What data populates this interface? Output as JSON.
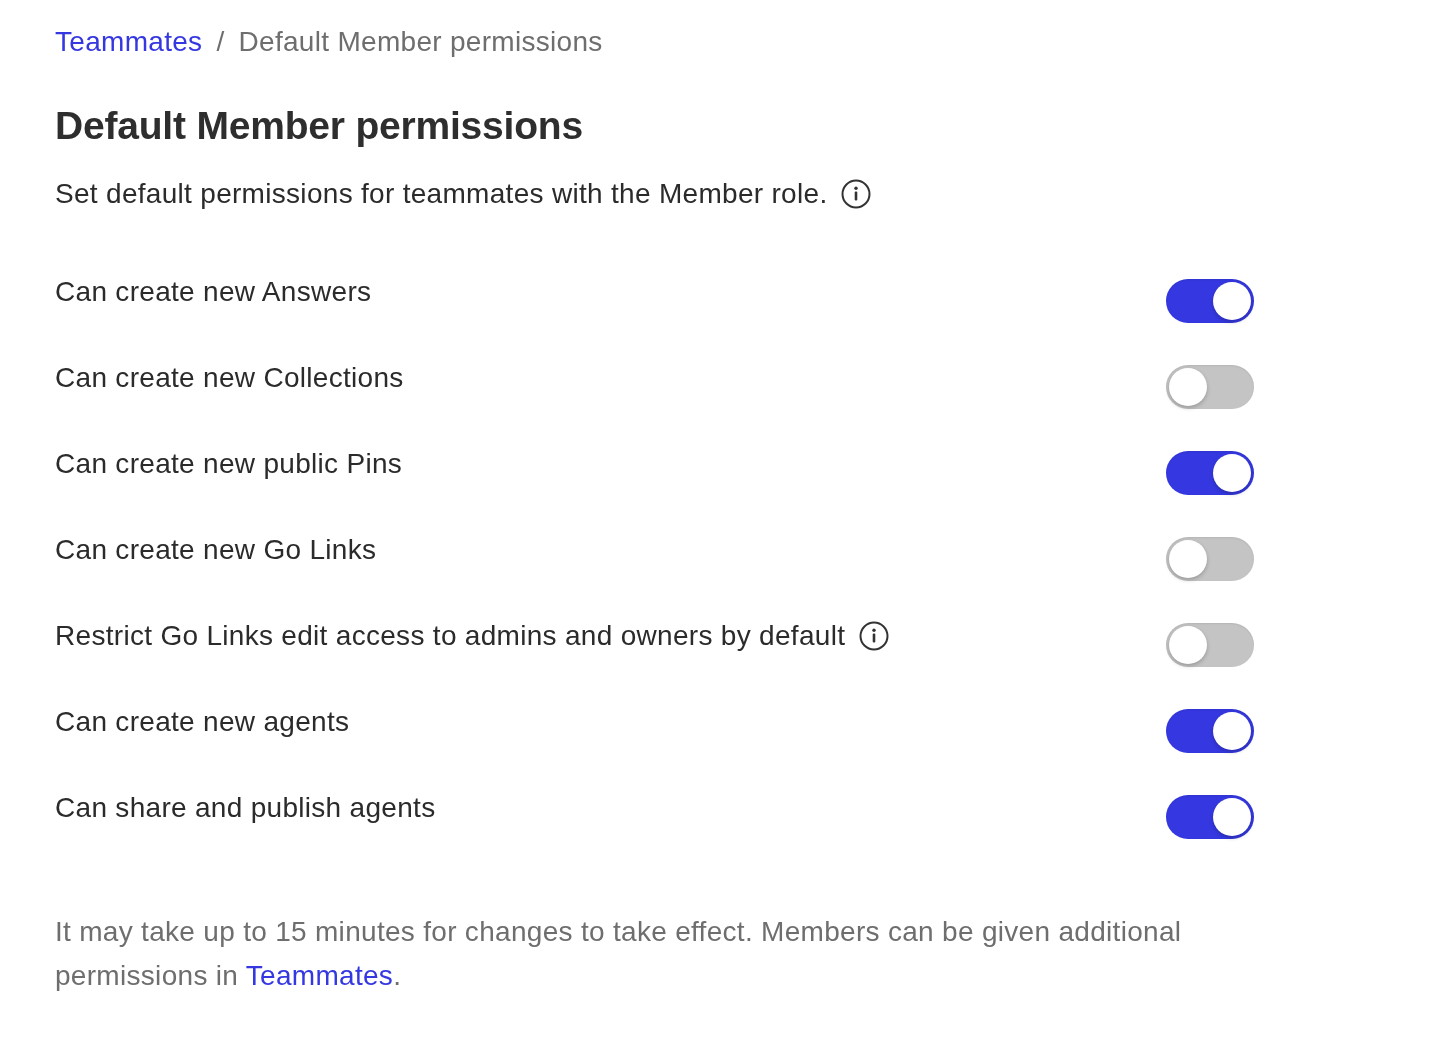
{
  "breadcrumb": {
    "link": "Teammates",
    "separator": "/",
    "current": "Default Member permissions"
  },
  "title": "Default Member permissions",
  "subtitle": {
    "text": "Set default permissions for teammates with the Member role.",
    "info": true
  },
  "permissions": [
    {
      "label": "Can create new Answers",
      "info": false,
      "on": true
    },
    {
      "label": "Can create new Collections",
      "info": false,
      "on": false
    },
    {
      "label": "Can create new public Pins",
      "info": false,
      "on": true
    },
    {
      "label": "Can create new Go Links",
      "info": false,
      "on": false
    },
    {
      "label": "Restrict Go Links edit access to admins and owners by default",
      "info": true,
      "on": false
    },
    {
      "label": "Can create new agents",
      "info": false,
      "on": true
    },
    {
      "label": "Can share and publish agents",
      "info": false,
      "on": true
    }
  ],
  "footer": {
    "text": "It may take up to 15 minutes for changes to take effect. Members can be given additional permissions in ",
    "link": "Teammates",
    "after": "."
  }
}
